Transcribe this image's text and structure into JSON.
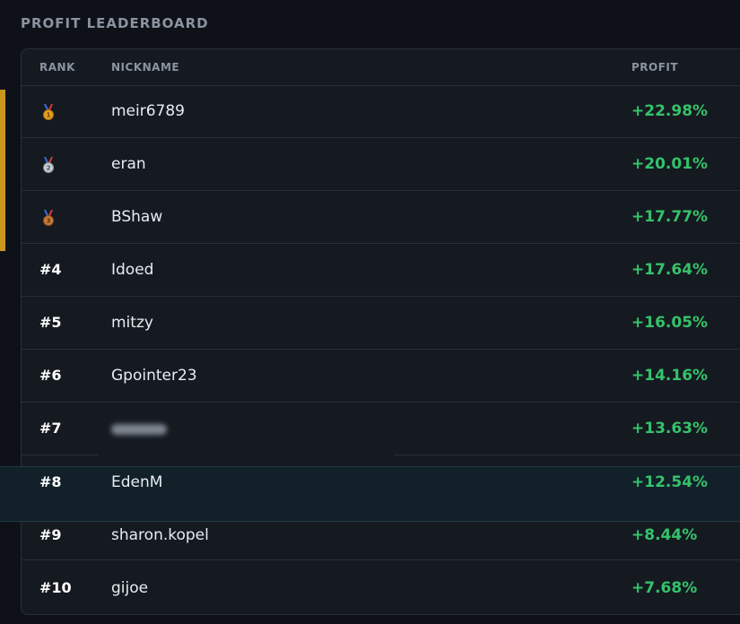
{
  "title": "PROFIT LEADERBOARD",
  "columns": {
    "rank": "RANK",
    "nickname": "NICKNAME",
    "profit": "PROFIT"
  },
  "colors": {
    "background": "#0e1218",
    "card": "#151a21",
    "accent": "#c9961e",
    "profit_positive": "#35c26a",
    "highlight": "#112029",
    "gold": "#e3a01f",
    "silver": "#c4cbd3",
    "bronze": "#c87a3a"
  },
  "rows": [
    {
      "rank": "1",
      "medal": "gold-medal-icon",
      "nickname": "meir6789",
      "profit": "+22.98%"
    },
    {
      "rank": "2",
      "medal": "silver-medal-icon",
      "nickname": "eran",
      "profit": "+20.01%"
    },
    {
      "rank": "3",
      "medal": "bronze-medal-icon",
      "nickname": "BShaw",
      "profit": "+17.77%"
    },
    {
      "rank": "#4",
      "nickname": "Idoed",
      "profit": "+17.64%"
    },
    {
      "rank": "#5",
      "nickname": "mitzy",
      "profit": "+16.05%"
    },
    {
      "rank": "#6",
      "nickname": "Gpointer23",
      "profit": "+14.16%"
    },
    {
      "rank": "#7",
      "nickname": "",
      "nickname_blurred": true,
      "profit": "+13.63%"
    },
    {
      "rank": "#8",
      "nickname": "EdenM",
      "profit": "+12.54%",
      "highlighted": true
    },
    {
      "rank": "#9",
      "nickname": "sharon.kopel",
      "profit": "+8.44%"
    },
    {
      "rank": "#10",
      "nickname": "gijoe",
      "profit": "+7.68%"
    }
  ]
}
